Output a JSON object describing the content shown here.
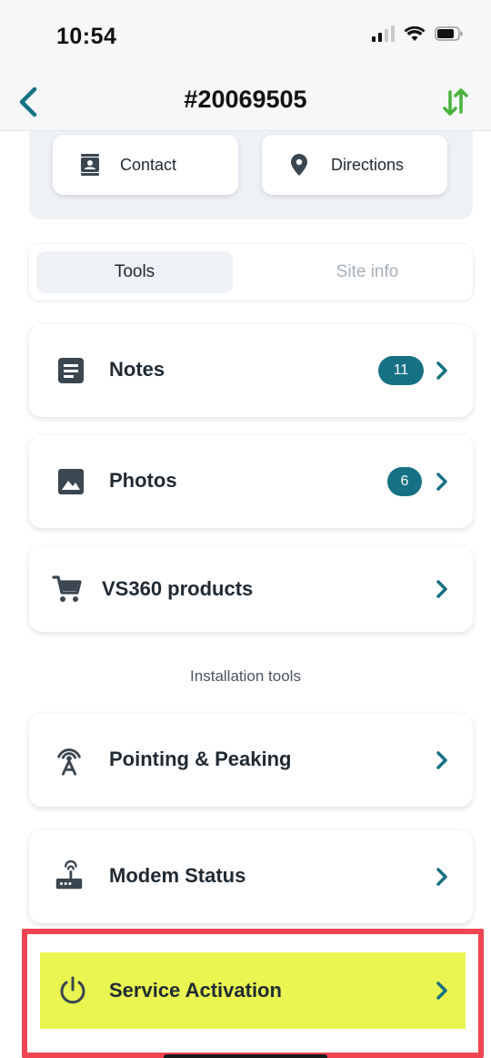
{
  "status_bar": {
    "time": "10:54"
  },
  "nav": {
    "title": "#20069505",
    "back_icon": "chevron-left-icon",
    "sync_icon": "sync-arrows-icon"
  },
  "actions": {
    "contact_label": "Contact",
    "directions_label": "Directions"
  },
  "tabs": [
    {
      "label": "Tools",
      "active": true
    },
    {
      "label": "Site info",
      "active": false
    }
  ],
  "tools": {
    "notes": {
      "label": "Notes",
      "count": "11"
    },
    "photos": {
      "label": "Photos",
      "count": "6"
    },
    "products": {
      "label": "VS360 products"
    }
  },
  "installation": {
    "section_title": "Installation tools",
    "pointing": {
      "label": "Pointing & Peaking"
    },
    "modem": {
      "label": "Modem Status"
    },
    "service": {
      "label": "Service Activation"
    }
  },
  "colors": {
    "accent": "#157183",
    "sync_green": "#47b43a",
    "highlight_border": "#f04452",
    "highlight_fill": "#eaf551"
  }
}
